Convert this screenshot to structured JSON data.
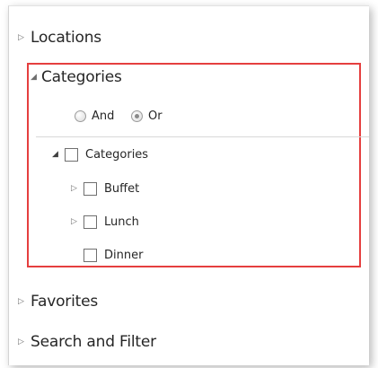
{
  "sections": {
    "locations": {
      "label": "Locations",
      "icon": "triangle-right-icon"
    },
    "categories": {
      "label": "Categories",
      "icon": "triangle-down-icon"
    },
    "favorites": {
      "label": "Favorites",
      "icon": "triangle-right-icon"
    },
    "search_filter": {
      "label": "Search and Filter",
      "icon": "triangle-right-icon"
    }
  },
  "categories_panel": {
    "mode": {
      "options": [
        {
          "label": "And",
          "checked": false
        },
        {
          "label": "Or",
          "checked": true
        }
      ]
    },
    "tree": {
      "root": {
        "label": "Categories",
        "expanded": true,
        "checked": false
      },
      "children": [
        {
          "label": "Buffet",
          "expandable": true,
          "checked": false
        },
        {
          "label": "Lunch",
          "expandable": true,
          "checked": false
        },
        {
          "label": "Dinner",
          "expandable": false,
          "checked": false
        }
      ]
    }
  },
  "colors": {
    "highlight_border": "#e53f3f",
    "text": "#262626",
    "divider": "#d8d8d8"
  }
}
